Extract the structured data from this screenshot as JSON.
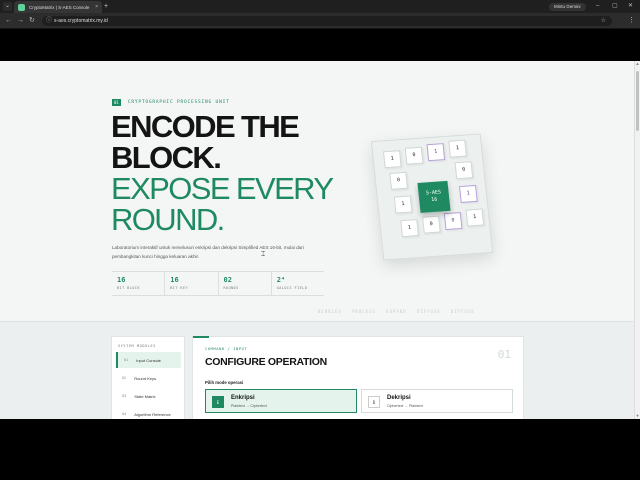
{
  "browser": {
    "tab_title": "CryptoMatrix | S-AES Console",
    "tab_close": "×",
    "new_tab": "+",
    "profile_label": "Mintu Gemini",
    "url": "s-aes.cryptomatrix.my.id",
    "minimize": "–",
    "maximize": "▢",
    "close": "✕",
    "back": "←",
    "forward": "→",
    "reload": "↻",
    "star": "☆",
    "menu": "⋮",
    "info_icon": "ⓘ",
    "menu_icon": "⌄"
  },
  "hero": {
    "badge_num": "01",
    "badge_label": "CRYPTOGRAPHIC PROCESSING UNIT",
    "title_line1": "ENCODE THE",
    "title_line2": "BLOCK.",
    "title_line3": "EXPOSE EVERY",
    "title_line4": "ROUND.",
    "description": "Laboratorium interaktif untuk menelusuri enkripsi dan dekripsi Simplified AES 16-bit, mulai dari pembangkitan kunci hingga keluaran akhir.",
    "stats": [
      {
        "value": "16",
        "label": "BIT BLOCK"
      },
      {
        "value": "16",
        "label": "BIT KEY"
      },
      {
        "value": "02",
        "label": "ROUNDS"
      },
      {
        "value": "2⁴",
        "label": "GALOIS FIELD"
      }
    ],
    "ticker": "NIBBLES · PROCESS · EXPAND · DIFFUSE · DIFFUSE"
  },
  "grid": {
    "core_line1": "S-AES",
    "core_line2": "16",
    "cells": [
      "1",
      "0",
      "1",
      "1",
      "0",
      "0",
      "1",
      "1",
      "1",
      "0",
      "0",
      "1",
      "0",
      "1",
      "0"
    ]
  },
  "sidebar": {
    "header": "SYSTEM MODULES",
    "items": [
      {
        "num": "01",
        "label": "Input Console"
      },
      {
        "num": "02",
        "label": "Round Keys"
      },
      {
        "num": "03",
        "label": "State Matrix"
      },
      {
        "num": "04",
        "label": "Algorithm Reference"
      }
    ]
  },
  "panel": {
    "crumb": "COMMAND / INPUT",
    "title": "CONFIGURE OPERATION",
    "number": "01",
    "mode_label": "Pilih mode operasi",
    "modes": [
      {
        "icon": "E",
        "title": "Enkripsi",
        "subtitle": "Plaintext → Ciphertext"
      },
      {
        "icon": "D",
        "title": "Dekripsi",
        "subtitle": "Ciphertext → Plaintext"
      }
    ]
  },
  "colors": {
    "accent": "#1f8a62",
    "ink": "#141414",
    "page_bg": "#f4f6f6"
  }
}
